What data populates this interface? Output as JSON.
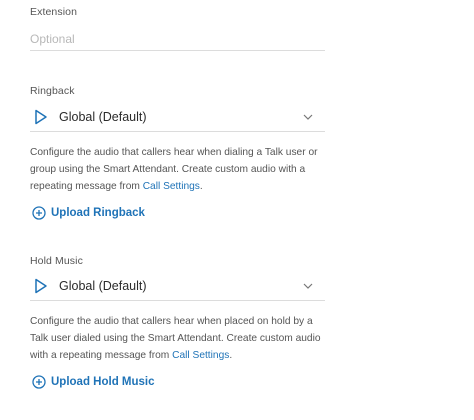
{
  "extension": {
    "label": "Extension",
    "placeholder": "Optional",
    "value": ""
  },
  "ringback": {
    "label": "Ringback",
    "selected": "Global (Default)",
    "desc_text": "Configure the audio that callers hear when dialing a Talk user or group using the Smart Attendant. Create custom audio with a repeating message from ",
    "desc_link": "Call Settings",
    "desc_end": ".",
    "upload_label": "Upload Ringback"
  },
  "hold_music": {
    "label": "Hold Music",
    "selected": "Global (Default)",
    "desc_text": "Configure the audio that callers hear when placed on hold by a Talk user dialed using the Smart Attendant. Create custom audio with a repeating message from ",
    "desc_link": "Call Settings",
    "desc_end": ".",
    "upload_label": "Upload Hold Music"
  },
  "colors": {
    "accent": "#1f73b7",
    "text": "#3c3c3c",
    "muted": "#b8b8b8",
    "divider": "#dcdcdc"
  },
  "icons": {
    "play": "play-icon",
    "chevron": "chevron-down-icon",
    "plus": "plus-circle-icon"
  }
}
